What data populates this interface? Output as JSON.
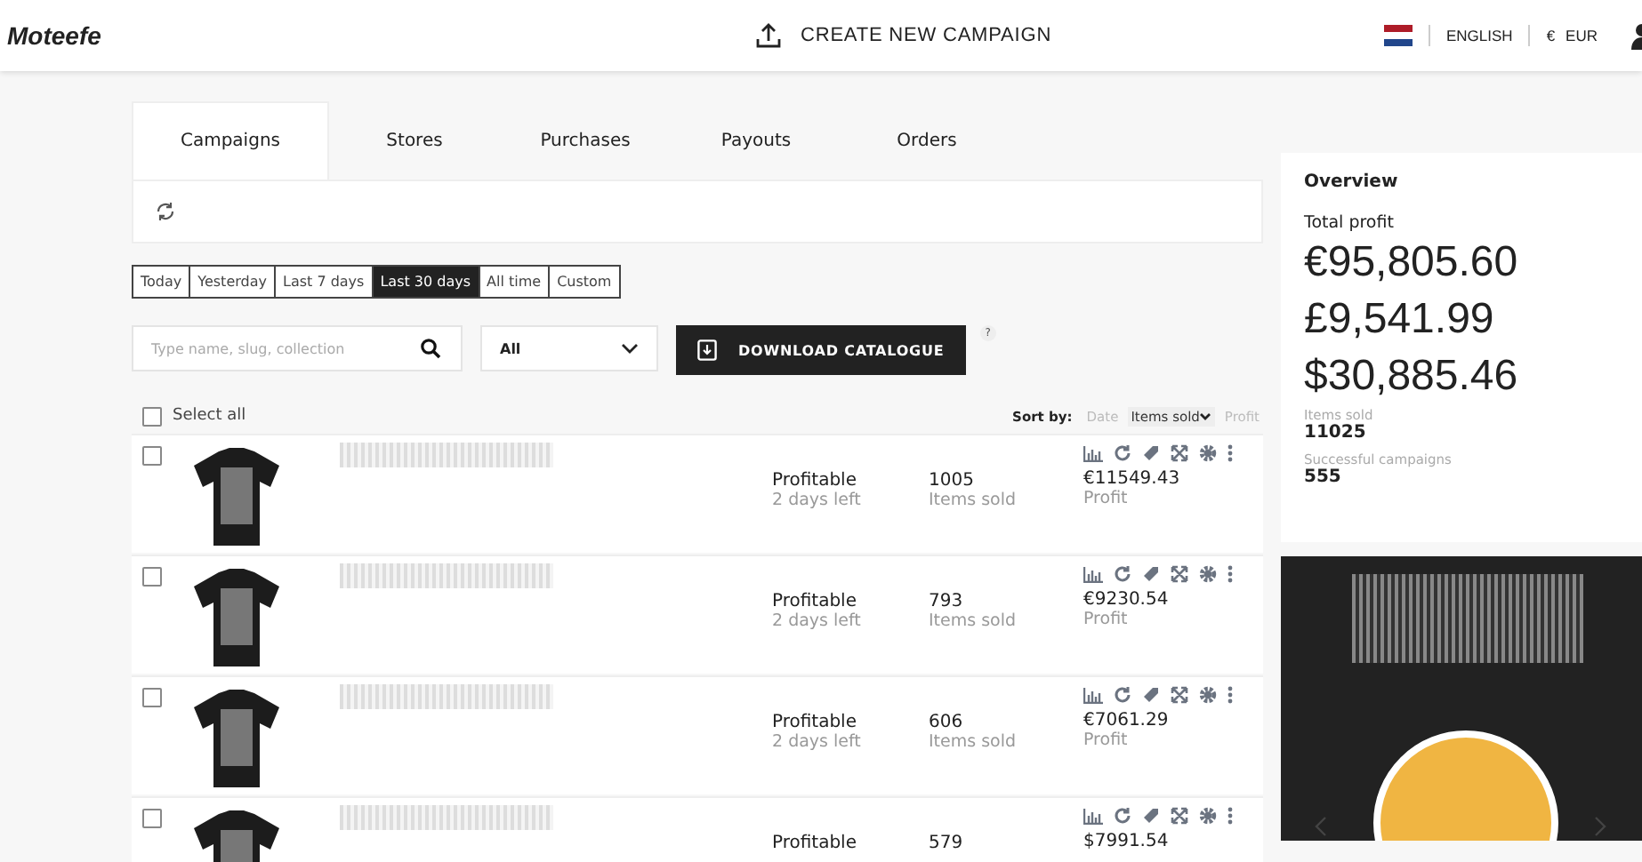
{
  "header": {
    "logo": "Moteefe",
    "create_button": "CREATE NEW CAMPAIGN",
    "language": "ENGLISH",
    "currency_symbol": "€",
    "currency": "EUR"
  },
  "tabs": [
    {
      "label": "Campaigns",
      "selected": true
    },
    {
      "label": "Stores",
      "selected": false
    },
    {
      "label": "Purchases",
      "selected": false
    },
    {
      "label": "Payouts",
      "selected": false
    },
    {
      "label": "Orders",
      "selected": false
    }
  ],
  "date_ranges": [
    {
      "label": "Today",
      "selected": false
    },
    {
      "label": "Yesterday",
      "selected": false
    },
    {
      "label": "Last 7 days",
      "selected": false
    },
    {
      "label": "Last 30 days",
      "selected": true
    },
    {
      "label": "All time",
      "selected": false
    },
    {
      "label": "Custom",
      "selected": false
    }
  ],
  "search": {
    "placeholder": "Type name, slug, collection"
  },
  "filter": {
    "value": "All"
  },
  "download_button": "DOWNLOAD CATALOGUE",
  "help": "?",
  "select_all": {
    "label": "Select all",
    "checked": false
  },
  "sort": {
    "label": "Sort by:",
    "options": [
      {
        "label": "Date",
        "selected": false
      },
      {
        "label": "Items sold",
        "selected": true
      },
      {
        "label": "Profit",
        "selected": false
      }
    ]
  },
  "campaigns": [
    {
      "checked": false,
      "status": "Profitable",
      "time_left": "2 days left",
      "items_sold": "1005",
      "items_label": "Items sold",
      "profit": "€11549.43",
      "profit_label": "Profit"
    },
    {
      "checked": false,
      "status": "Profitable",
      "time_left": "2 days left",
      "items_sold": "793",
      "items_label": "Items sold",
      "profit": "€9230.54",
      "profit_label": "Profit"
    },
    {
      "checked": false,
      "status": "Profitable",
      "time_left": "2 days left",
      "items_sold": "606",
      "items_label": "Items sold",
      "profit": "€7061.29",
      "profit_label": "Profit"
    },
    {
      "checked": false,
      "status": "Profitable",
      "items_sold": "579",
      "profit": "$7991.54"
    }
  ],
  "overview": {
    "title": "Overview",
    "total_label": "Total profit",
    "totals": [
      "€95,805.60",
      "£9,541.99",
      "$30,885.46"
    ],
    "items_label": "Items sold",
    "items": "11025",
    "campaigns_label": "Successful campaigns",
    "campaigns": "555"
  }
}
